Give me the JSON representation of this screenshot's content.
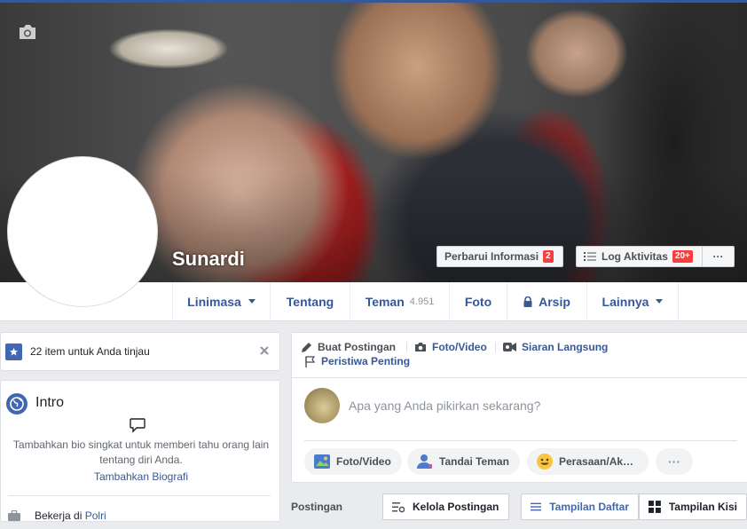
{
  "profile": {
    "name": "Sunardi"
  },
  "cover": {
    "update_info_label": "Perbarui Informasi",
    "update_info_badge": "2",
    "activity_log_label": "Log Aktivitas",
    "activity_log_badge": "20+",
    "more_label": "···"
  },
  "nav": {
    "timeline": "Linimasa",
    "about": "Tentang",
    "friends": "Teman",
    "friends_count": "4.951",
    "photos": "Foto",
    "archive": "Arsip",
    "more": "Lainnya"
  },
  "review": {
    "text": "22 item untuk Anda tinjau"
  },
  "intro": {
    "title": "Intro",
    "description": "Tambahkan bio singkat untuk memberi tahu orang lain tentang diri Anda.",
    "add_bio": "Tambahkan Biografi",
    "work_prefix": "Bekerja di",
    "work_place": "Polri"
  },
  "composer": {
    "create_post": "Buat Postingan",
    "photo_video_tab": "Foto/Video",
    "live": "Siaran Langsung",
    "life_event": "Peristiwa Penting",
    "placeholder": "Apa yang Anda pikirkan sekarang?",
    "photo_video": "Foto/Video",
    "tag_friends": "Tandai Teman",
    "feeling": "Perasaan/Ak…",
    "more": "···"
  },
  "posts": {
    "label": "Postingan",
    "manage": "Kelola Postingan",
    "list_view": "Tampilan Daftar",
    "grid_view": "Tampilan Kisi"
  },
  "colors": {
    "brand": "#4267b2",
    "link": "#365899",
    "badge": "#fa3e3e"
  }
}
